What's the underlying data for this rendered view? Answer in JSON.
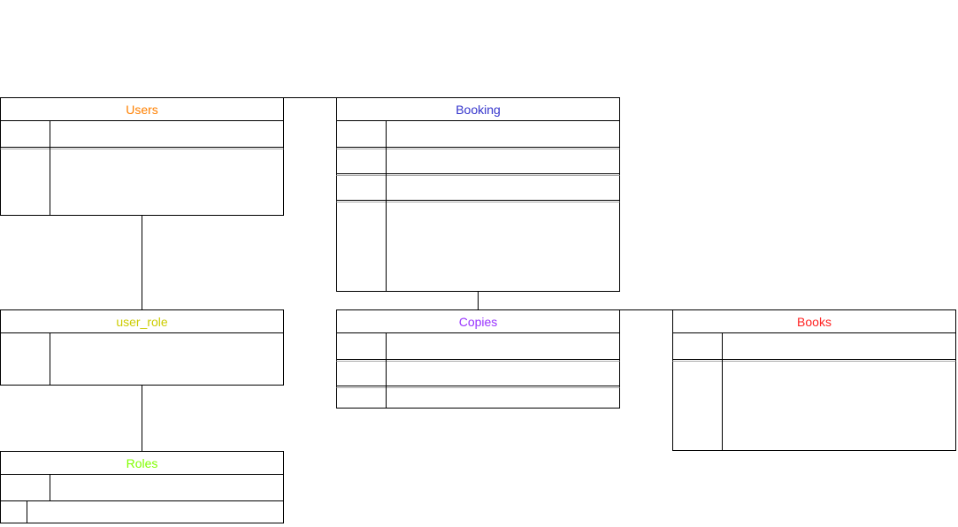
{
  "diagram": {
    "tables": {
      "users": {
        "title": "Users",
        "color": "#ff8000"
      },
      "booking": {
        "title": "Booking",
        "color": "#3333cc"
      },
      "user_role": {
        "title": "user_role",
        "color": "#cccc00"
      },
      "copies": {
        "title": "Copies",
        "color": "#9933ff"
      },
      "books": {
        "title": "Books",
        "color": "#ff2222"
      },
      "roles": {
        "title": "Roles",
        "color": "#80ff00"
      }
    },
    "relations": [
      {
        "from": "users",
        "to": "booking"
      },
      {
        "from": "users",
        "to": "user_role"
      },
      {
        "from": "user_role",
        "to": "roles"
      },
      {
        "from": "booking",
        "to": "copies"
      },
      {
        "from": "copies",
        "to": "books"
      }
    ]
  }
}
